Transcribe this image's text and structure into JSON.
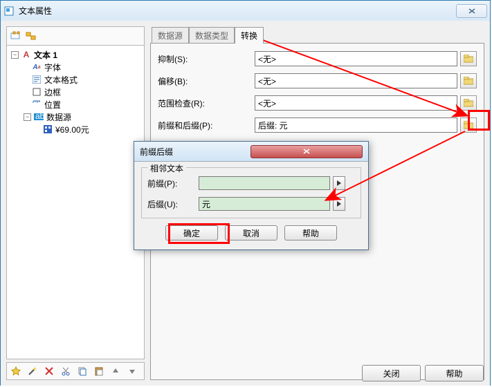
{
  "window": {
    "title": "文本属性"
  },
  "tree": {
    "root": "文本 1",
    "children": [
      {
        "label": "字体"
      },
      {
        "label": "文本格式"
      },
      {
        "label": "边框"
      },
      {
        "label": "位置"
      },
      {
        "label": "数据源",
        "children": [
          {
            "label": "¥69.00元"
          }
        ]
      }
    ]
  },
  "tabs": {
    "items": [
      "数据源",
      "数据类型",
      "转换"
    ],
    "active_index": 2
  },
  "fields": {
    "suppress": {
      "label": "抑制(S):",
      "value": "<无>"
    },
    "offset": {
      "label": "偏移(B):",
      "value": "<无>"
    },
    "range_check": {
      "label": "范围检查(R):",
      "value": "<无>"
    },
    "prefix_suffix": {
      "label": "前缀和后缀(P):",
      "value": "后缀: 元"
    }
  },
  "buttons": {
    "close": "关闭",
    "help": "帮助"
  },
  "dialog": {
    "title": "前缀后缀",
    "group_title": "相邻文本",
    "prefix": {
      "label": "前缀(P):",
      "value": ""
    },
    "suffix": {
      "label": "后缀(U):",
      "value": "元"
    },
    "ok": "确定",
    "cancel": "取消",
    "help": "帮助"
  }
}
